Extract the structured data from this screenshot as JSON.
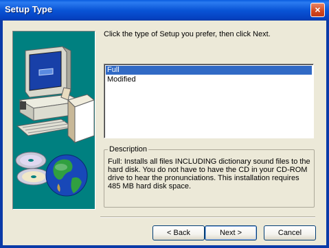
{
  "window": {
    "title": "Setup Type",
    "close_label": "×"
  },
  "instruction": "Click the type of Setup you prefer, then click Next.",
  "setup_types": {
    "selected": "Full",
    "items": [
      {
        "label": "Full"
      },
      {
        "label": "Modified"
      }
    ]
  },
  "description": {
    "legend": "Description",
    "text": "Full: Installs all files INCLUDING dictionary sound files to the hard disk.  You do not have to have the CD in your CD-ROM drive to hear the pronunciations.  This installation requires 485 MB hard disk space."
  },
  "buttons": {
    "back": "< Back",
    "next": "Next >",
    "cancel": "Cancel"
  },
  "colors": {
    "titlebar": "#0a5de0",
    "panel": "#008080",
    "selection": "#316ac5",
    "dialog": "#ece9d8"
  }
}
